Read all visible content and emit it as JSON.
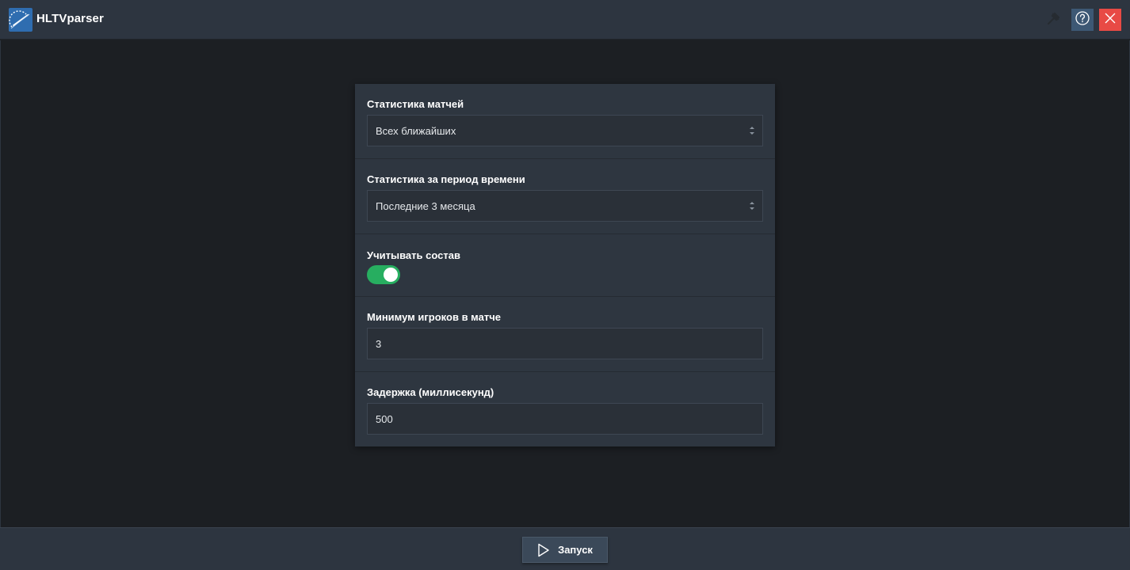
{
  "window": {
    "title": "HLTVparser",
    "icons": {
      "logo": "speedometer-logo-icon",
      "pin": "pin-icon",
      "help": "help-icon",
      "close": "close-icon"
    },
    "colors": {
      "titlebar": "#2d3540",
      "background": "#1c1f23",
      "close": "#e84a45",
      "help": "#3d5874",
      "accent_logo": "#2f6db0"
    }
  },
  "settings": {
    "match_stats": {
      "label": "Статистика матчей",
      "value": "Всех ближайших"
    },
    "period_stats": {
      "label": "Статистика за период времени",
      "value": "Последние 3 месяца"
    },
    "consider_roster": {
      "label": "Учитывать состав",
      "enabled": true,
      "toggle_color": "#27ae60"
    },
    "min_players": {
      "label": "Минимум игроков в матче",
      "value": "3"
    },
    "delay": {
      "label": "Задержка (миллисекунд)",
      "value": "500"
    }
  },
  "footer": {
    "run_label": "Запуск",
    "run_icon": "play-icon"
  }
}
